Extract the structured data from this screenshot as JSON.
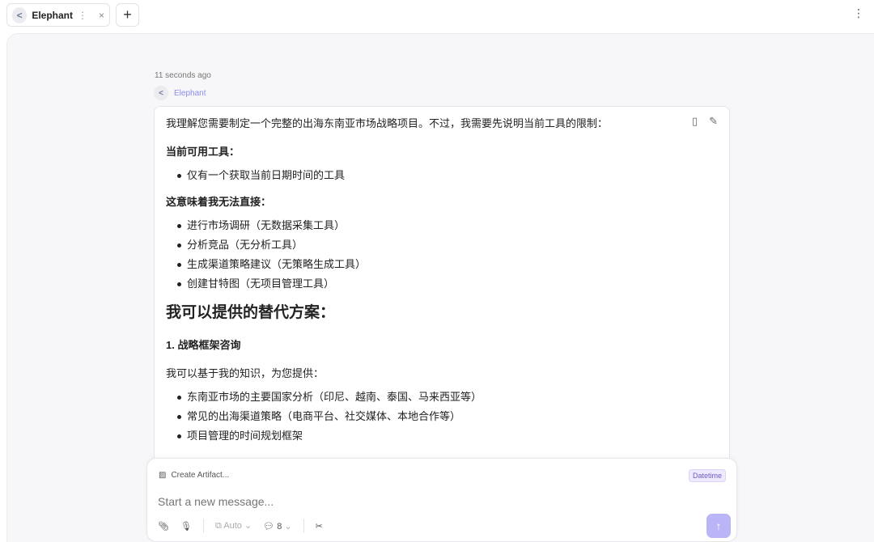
{
  "tab": {
    "title": "Elephant",
    "menu_icon": "⋮",
    "close_icon": "×"
  },
  "new_tab": "+",
  "app_menu": "⋮",
  "message": {
    "time": "11 seconds ago",
    "sender": "Elephant",
    "intro": "我理解您需要制定一个完整的出海东南亚市场战略项目。不过，我需要先说明当前工具的限制：",
    "h_tools": "当前可用工具：",
    "tools": [
      "仅有一个获取当前日期时间的工具"
    ],
    "h_cannot": "这意味着我无法直接：",
    "cannot": [
      "进行市场调研（无数据采集工具）",
      "分析竞品（无分析工具）",
      "生成渠道策略建议（无策略生成工具）",
      "创建甘特图（无项目管理工具）"
    ],
    "h2": "我可以提供的替代方案：",
    "h3": "1. 战略框架咨询",
    "p2": "我可以基于我的知识，为您提供：",
    "offer": [
      "东南亚市场的主要国家分析（印尼、越南、泰国、马来西亚等）",
      "常见的出海渠道策略（电商平台、社交媒体、本地合作等）",
      "项目管理的时间规划框架"
    ]
  },
  "composer": {
    "artifact": "Create Artifact...",
    "badge": "Datetime",
    "placeholder": "Start a new message...",
    "mode": "Auto",
    "count": "8"
  }
}
